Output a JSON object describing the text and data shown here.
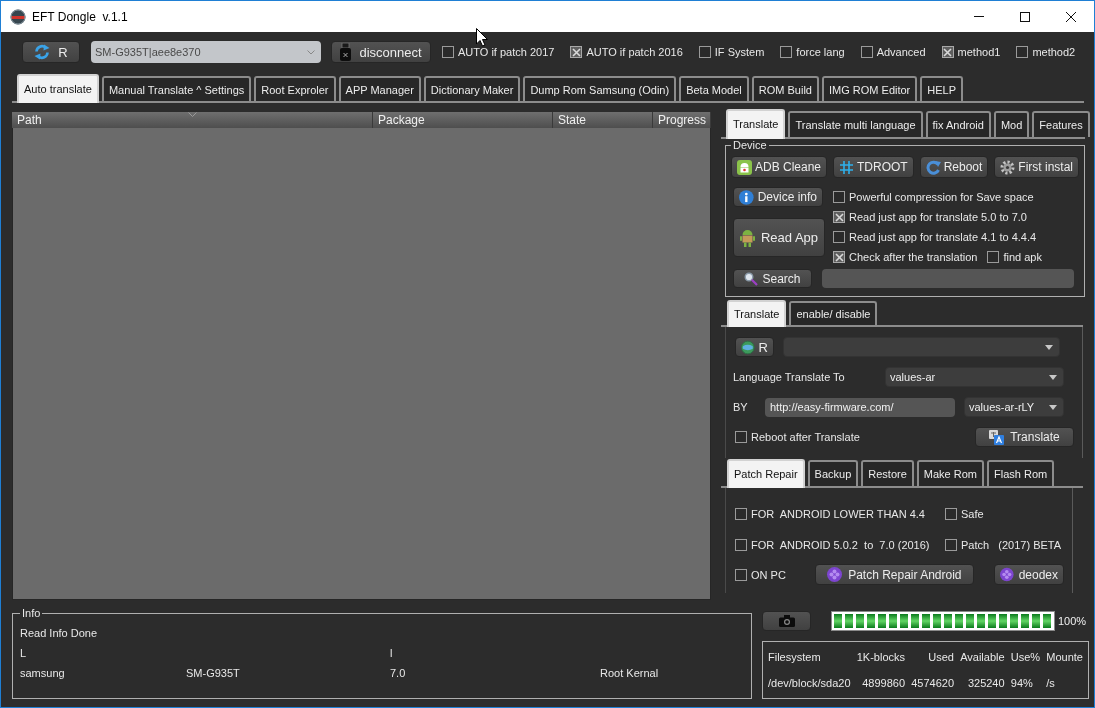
{
  "window": {
    "title": "EFT Dongle  v.1.1"
  },
  "toolbar": {
    "refresh_button": "R",
    "device_select": "SM-G935T|aee8e370",
    "disconnect_button": "disconnect",
    "options": [
      {
        "label": "AUTO if patch 2017",
        "checked": false
      },
      {
        "label": "AUTO if patch 2016",
        "checked": true
      },
      {
        "label": "IF System",
        "checked": false
      },
      {
        "label": "force lang",
        "checked": false
      },
      {
        "label": "Advanced",
        "checked": false
      },
      {
        "label": "method1",
        "checked": true
      },
      {
        "label": "method2",
        "checked": false
      }
    ]
  },
  "main_tabs": [
    {
      "label": "Auto translate",
      "selected": true
    },
    {
      "label": "Manual Translate ^ Settings",
      "selected": false
    },
    {
      "label": "Root Exproler",
      "selected": false
    },
    {
      "label": "APP Manager",
      "selected": false
    },
    {
      "label": "Dictionary Maker",
      "selected": false
    },
    {
      "label": "Dump Rom Samsung (Odin)",
      "selected": false
    },
    {
      "label": "Beta Model",
      "selected": false
    },
    {
      "label": "ROM Build",
      "selected": false
    },
    {
      "label": "IMG ROM Editor",
      "selected": false
    },
    {
      "label": "HELP",
      "selected": false
    }
  ],
  "table": {
    "columns": [
      "Path",
      "Package",
      "State",
      "Progress"
    ]
  },
  "right_tabs": [
    {
      "label": "Translate",
      "selected": true
    },
    {
      "label": "Translate multi language",
      "selected": false
    },
    {
      "label": "fix Android",
      "selected": false
    },
    {
      "label": "Mod",
      "selected": false
    },
    {
      "label": "Features",
      "selected": false
    }
  ],
  "device": {
    "title": "Device",
    "buttons": [
      "ADB Cleane",
      "TDROOT",
      "Reboot",
      "First instal"
    ],
    "device_info_button": "Device info",
    "read_app_button": "Read App",
    "options": [
      {
        "label": "Powerful compression for Save space",
        "checked": false
      },
      {
        "label": "Read just app for translate 5.0 to 7.0",
        "checked": true
      },
      {
        "label": "Read just app for translate 4.1 to 4.4.4",
        "checked": false
      },
      {
        "label": "Check after the translation",
        "checked": true
      }
    ],
    "find_apk": {
      "label": "find apk",
      "checked": false
    },
    "search_button": "Search"
  },
  "translate_tabs": [
    {
      "label": "Translate",
      "selected": true
    },
    {
      "label": "enable/ disable",
      "selected": false
    }
  ],
  "translate_pane": {
    "refresh_button": "R",
    "language_label": "Language Translate To",
    "language_select": "values-ar",
    "by_label": "BY",
    "url_field": "http://easy-firmware.com/",
    "region_select": "values-ar-rLY",
    "reboot_option": {
      "label": "Reboot after Translate",
      "checked": false
    },
    "translate_button": "Translate"
  },
  "patch_tabs": [
    {
      "label": "Patch Repair",
      "selected": true
    },
    {
      "label": "Backup",
      "selected": false
    },
    {
      "label": "Restore",
      "selected": false
    },
    {
      "label": "Make Rom",
      "selected": false
    },
    {
      "label": "Flash Rom",
      "selected": false
    }
  ],
  "patch_pane": {
    "options": [
      {
        "label": "FOR  ANDROID LOWER THAN 4.4",
        "checked": false
      },
      {
        "label": "Safe",
        "checked": false
      },
      {
        "label": "FOR  ANDROID 5.0.2  to  7.0 (2016)",
        "checked": false
      },
      {
        "label": "Patch   (2017) BETA",
        "checked": false
      },
      {
        "label": "ON PC",
        "checked": false
      }
    ],
    "repair_button": "Patch Repair Android",
    "deodex_button": "deodex"
  },
  "info": {
    "title": "Info",
    "status": "Read Info Done",
    "marks": [
      "L",
      "l"
    ],
    "device_row": [
      "samsung",
      "SM-G935T",
      "7.0",
      "Root Kernal"
    ]
  },
  "progress": {
    "level": 1,
    "reading": "100%"
  },
  "filesystem": {
    "columns": [
      "Filesystem",
      "1K-blocks",
      "Used",
      "Available",
      "Use%",
      "Mounte"
    ],
    "row": [
      "/dev/block/sda20",
      "4899860",
      "4574620",
      "325240",
      "94%",
      "/s"
    ]
  }
}
